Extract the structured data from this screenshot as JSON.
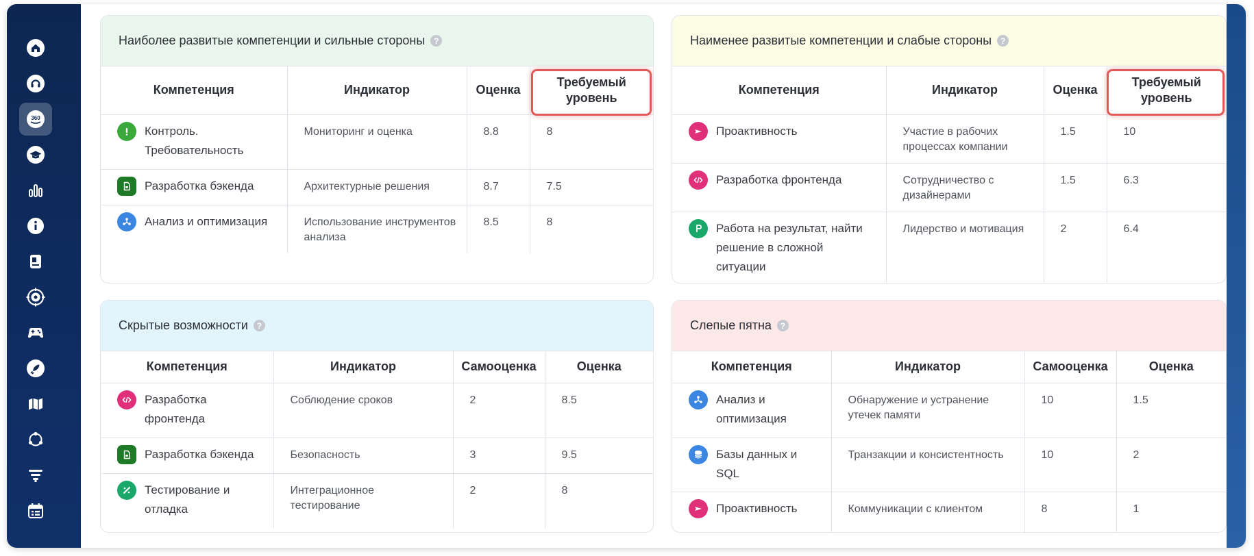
{
  "colors": {
    "sidebar": "#0d2752",
    "highlight": "#e05a5a",
    "green_icon": "#3aa83a",
    "dark_green_icon": "#1f7a28",
    "blue_icon": "#3a86e0",
    "pink_icon": "#e0307a",
    "teal_icon": "#1aa86a"
  },
  "sidebar": {
    "items": [
      {
        "icon": "home-icon"
      },
      {
        "icon": "support-icon"
      },
      {
        "icon": "360-icon",
        "label": "360"
      },
      {
        "icon": "graduation-cap-icon"
      },
      {
        "icon": "bar-chart-icon"
      },
      {
        "icon": "info-icon"
      },
      {
        "icon": "book-icon"
      },
      {
        "icon": "target-icon"
      },
      {
        "icon": "gamepad-icon"
      },
      {
        "icon": "rocket-icon"
      },
      {
        "icon": "map-icon"
      },
      {
        "icon": "cycle-icon"
      },
      {
        "icon": "filter-icon"
      },
      {
        "icon": "calendar-icon"
      }
    ]
  },
  "strengths": {
    "title": "Наиболее развитые компетенции и сильные стороны",
    "headers": [
      "Компетенция",
      "Индикатор",
      "Оценка",
      "Требуемый уровень"
    ],
    "rows": [
      {
        "icon": "exclamation-icon",
        "competence": "Контроль. Требовательность",
        "indicator": "Мониторинг и оценка",
        "score": "8.8",
        "required": "8"
      },
      {
        "icon": "backend-icon",
        "competence": "Разработка бэкенда",
        "indicator": "Архитектурные решения",
        "score": "8.7",
        "required": "7.5"
      },
      {
        "icon": "analysis-icon",
        "competence": "Анализ и оптимизация",
        "indicator": "Использование инструментов анализа",
        "score": "8.5",
        "required": "8"
      }
    ]
  },
  "weaknesses": {
    "title": "Наименее развитые компетенции и слабые стороны",
    "headers": [
      "Компетенция",
      "Индикатор",
      "Оценка",
      "Требуемый уровень"
    ],
    "rows": [
      {
        "icon": "proactive-icon",
        "competence": "Проактивность",
        "indicator": "Участие в рабочих процессах компании",
        "score": "1.5",
        "required": "10"
      },
      {
        "icon": "code-icon",
        "competence": "Разработка фронтенда",
        "indicator": "Сотрудничество с дизайнерами",
        "score": "1.5",
        "required": "6.3"
      },
      {
        "icon": "result-icon",
        "competence": "Работа на результат, найти решение в сложной ситуации",
        "indicator": "Лидерство и мотивация",
        "score": "2",
        "required": "6.4"
      }
    ]
  },
  "hidden": {
    "title": "Скрытые возможности",
    "headers": [
      "Компетенция",
      "Индикатор",
      "Самооценка",
      "Оценка"
    ],
    "rows": [
      {
        "icon": "code-icon",
        "competence": "Разработка фронтенда",
        "indicator": "Соблюдение сроков",
        "self": "2",
        "score": "8.5"
      },
      {
        "icon": "backend-icon",
        "competence": "Разработка бэкенда",
        "indicator": "Безопасность",
        "self": "3",
        "score": "9.5"
      },
      {
        "icon": "testing-icon",
        "competence": "Тестирование и отладка",
        "indicator": "Интеграционное тестирование",
        "self": "2",
        "score": "8"
      }
    ]
  },
  "blind": {
    "title": "Слепые пятна",
    "headers": [
      "Компетенция",
      "Индикатор",
      "Самооценка",
      "Оценка"
    ],
    "rows": [
      {
        "icon": "analysis-icon",
        "competence": "Анализ и оптимизация",
        "indicator": "Обнаружение и устранение утечек памяти",
        "self": "10",
        "score": "1.5"
      },
      {
        "icon": "database-icon",
        "competence": "Базы данных и SQL",
        "indicator": "Транзакции и консистентность",
        "self": "10",
        "score": "2"
      },
      {
        "icon": "proactive-icon",
        "competence": "Проактивность",
        "indicator": "Коммуникации с клиентом",
        "self": "8",
        "score": "1"
      }
    ]
  }
}
